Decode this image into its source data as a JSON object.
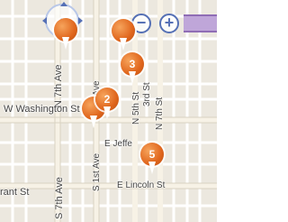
{
  "map": {
    "compass": {
      "letter": "N"
    },
    "zoom": {
      "out_label": "−",
      "in_label": "+"
    },
    "streets": {
      "n_7th_ave": "N 7th Ave",
      "w_washington_st": "W Washington St",
      "s_7th_ave": "S 7th Ave",
      "grant_st": "rant St",
      "s_1st_ave": "S 1st Ave",
      "n_1st_ave": "N 1st Ave",
      "e_jefferson": "E Jeffe",
      "e_lincoln_st": "E Lincoln St",
      "n_5th_st": "N 5th St",
      "n_7th_st": "N 7th St",
      "n_3rd_st": "3rd St"
    },
    "markers": [
      {
        "label": ""
      },
      {
        "label": ""
      },
      {
        "label": "3"
      },
      {
        "label": ""
      },
      {
        "label": "2"
      },
      {
        "label": "5"
      }
    ]
  }
}
